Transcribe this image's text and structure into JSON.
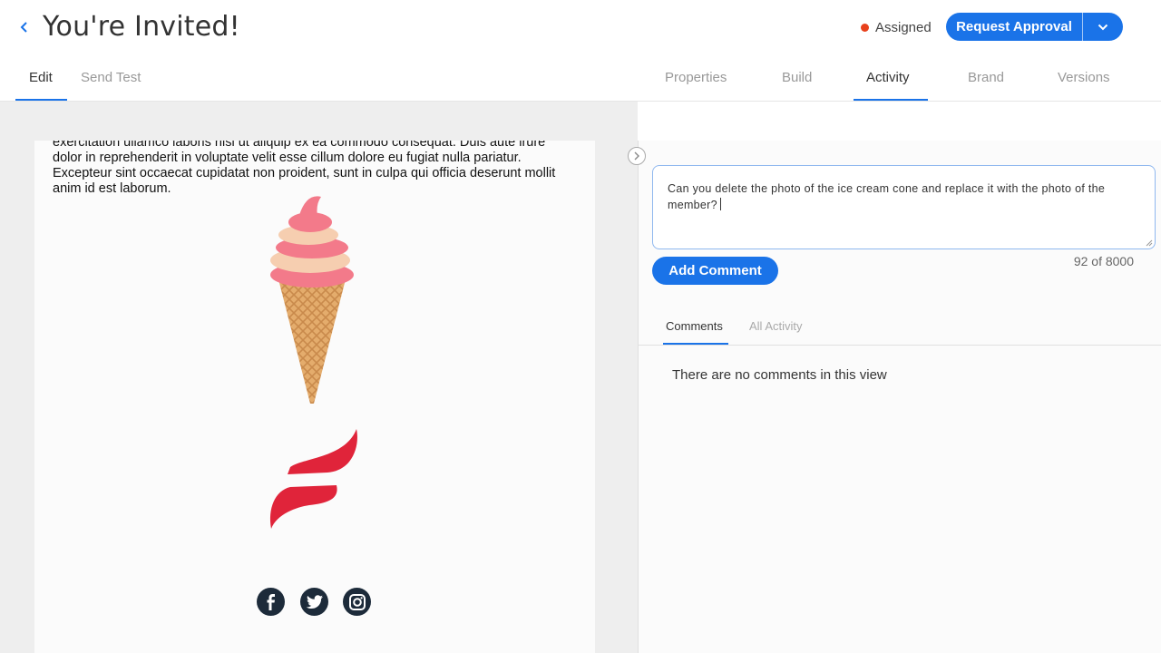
{
  "header": {
    "back_icon": "chevron-left-icon",
    "title": "You're Invited!",
    "status_label": "Assigned",
    "status_color": "#e8411c",
    "approve_label": "Request Approval",
    "accent_color": "#1a73e8"
  },
  "left_tabs": [
    {
      "label": "Edit",
      "active": true
    },
    {
      "label": "Send Test",
      "active": false
    }
  ],
  "right_tabs": [
    {
      "label": "Properties",
      "active": false
    },
    {
      "label": "Build",
      "active": false
    },
    {
      "label": "Activity",
      "active": true
    },
    {
      "label": "Brand",
      "active": false
    },
    {
      "label": "Versions",
      "active": false
    }
  ],
  "editor": {
    "body_text": "exercitation ullamco laboris nisi ut aliquip ex ea commodo consequat. Duis aute irure dolor in reprehenderit in voluptate velit esse cillum dolore eu fugiat nulla pariatur. Excepteur sint occaecat cupidatat non proident, sunt in culpa qui officia deserunt mollit anim id est laborum.",
    "social_icons": [
      "facebook-icon",
      "twitter-icon",
      "instagram-icon"
    ]
  },
  "activity": {
    "comment_text": "Can you delete the photo of the ice cream cone and replace it with the photo of the member?",
    "add_comment_label": "Add Comment",
    "char_count": "92 of 8000",
    "tabs": [
      {
        "label": "Comments",
        "active": true
      },
      {
        "label": "All Activity",
        "active": false
      }
    ],
    "empty_message": "There are no comments in this view"
  }
}
